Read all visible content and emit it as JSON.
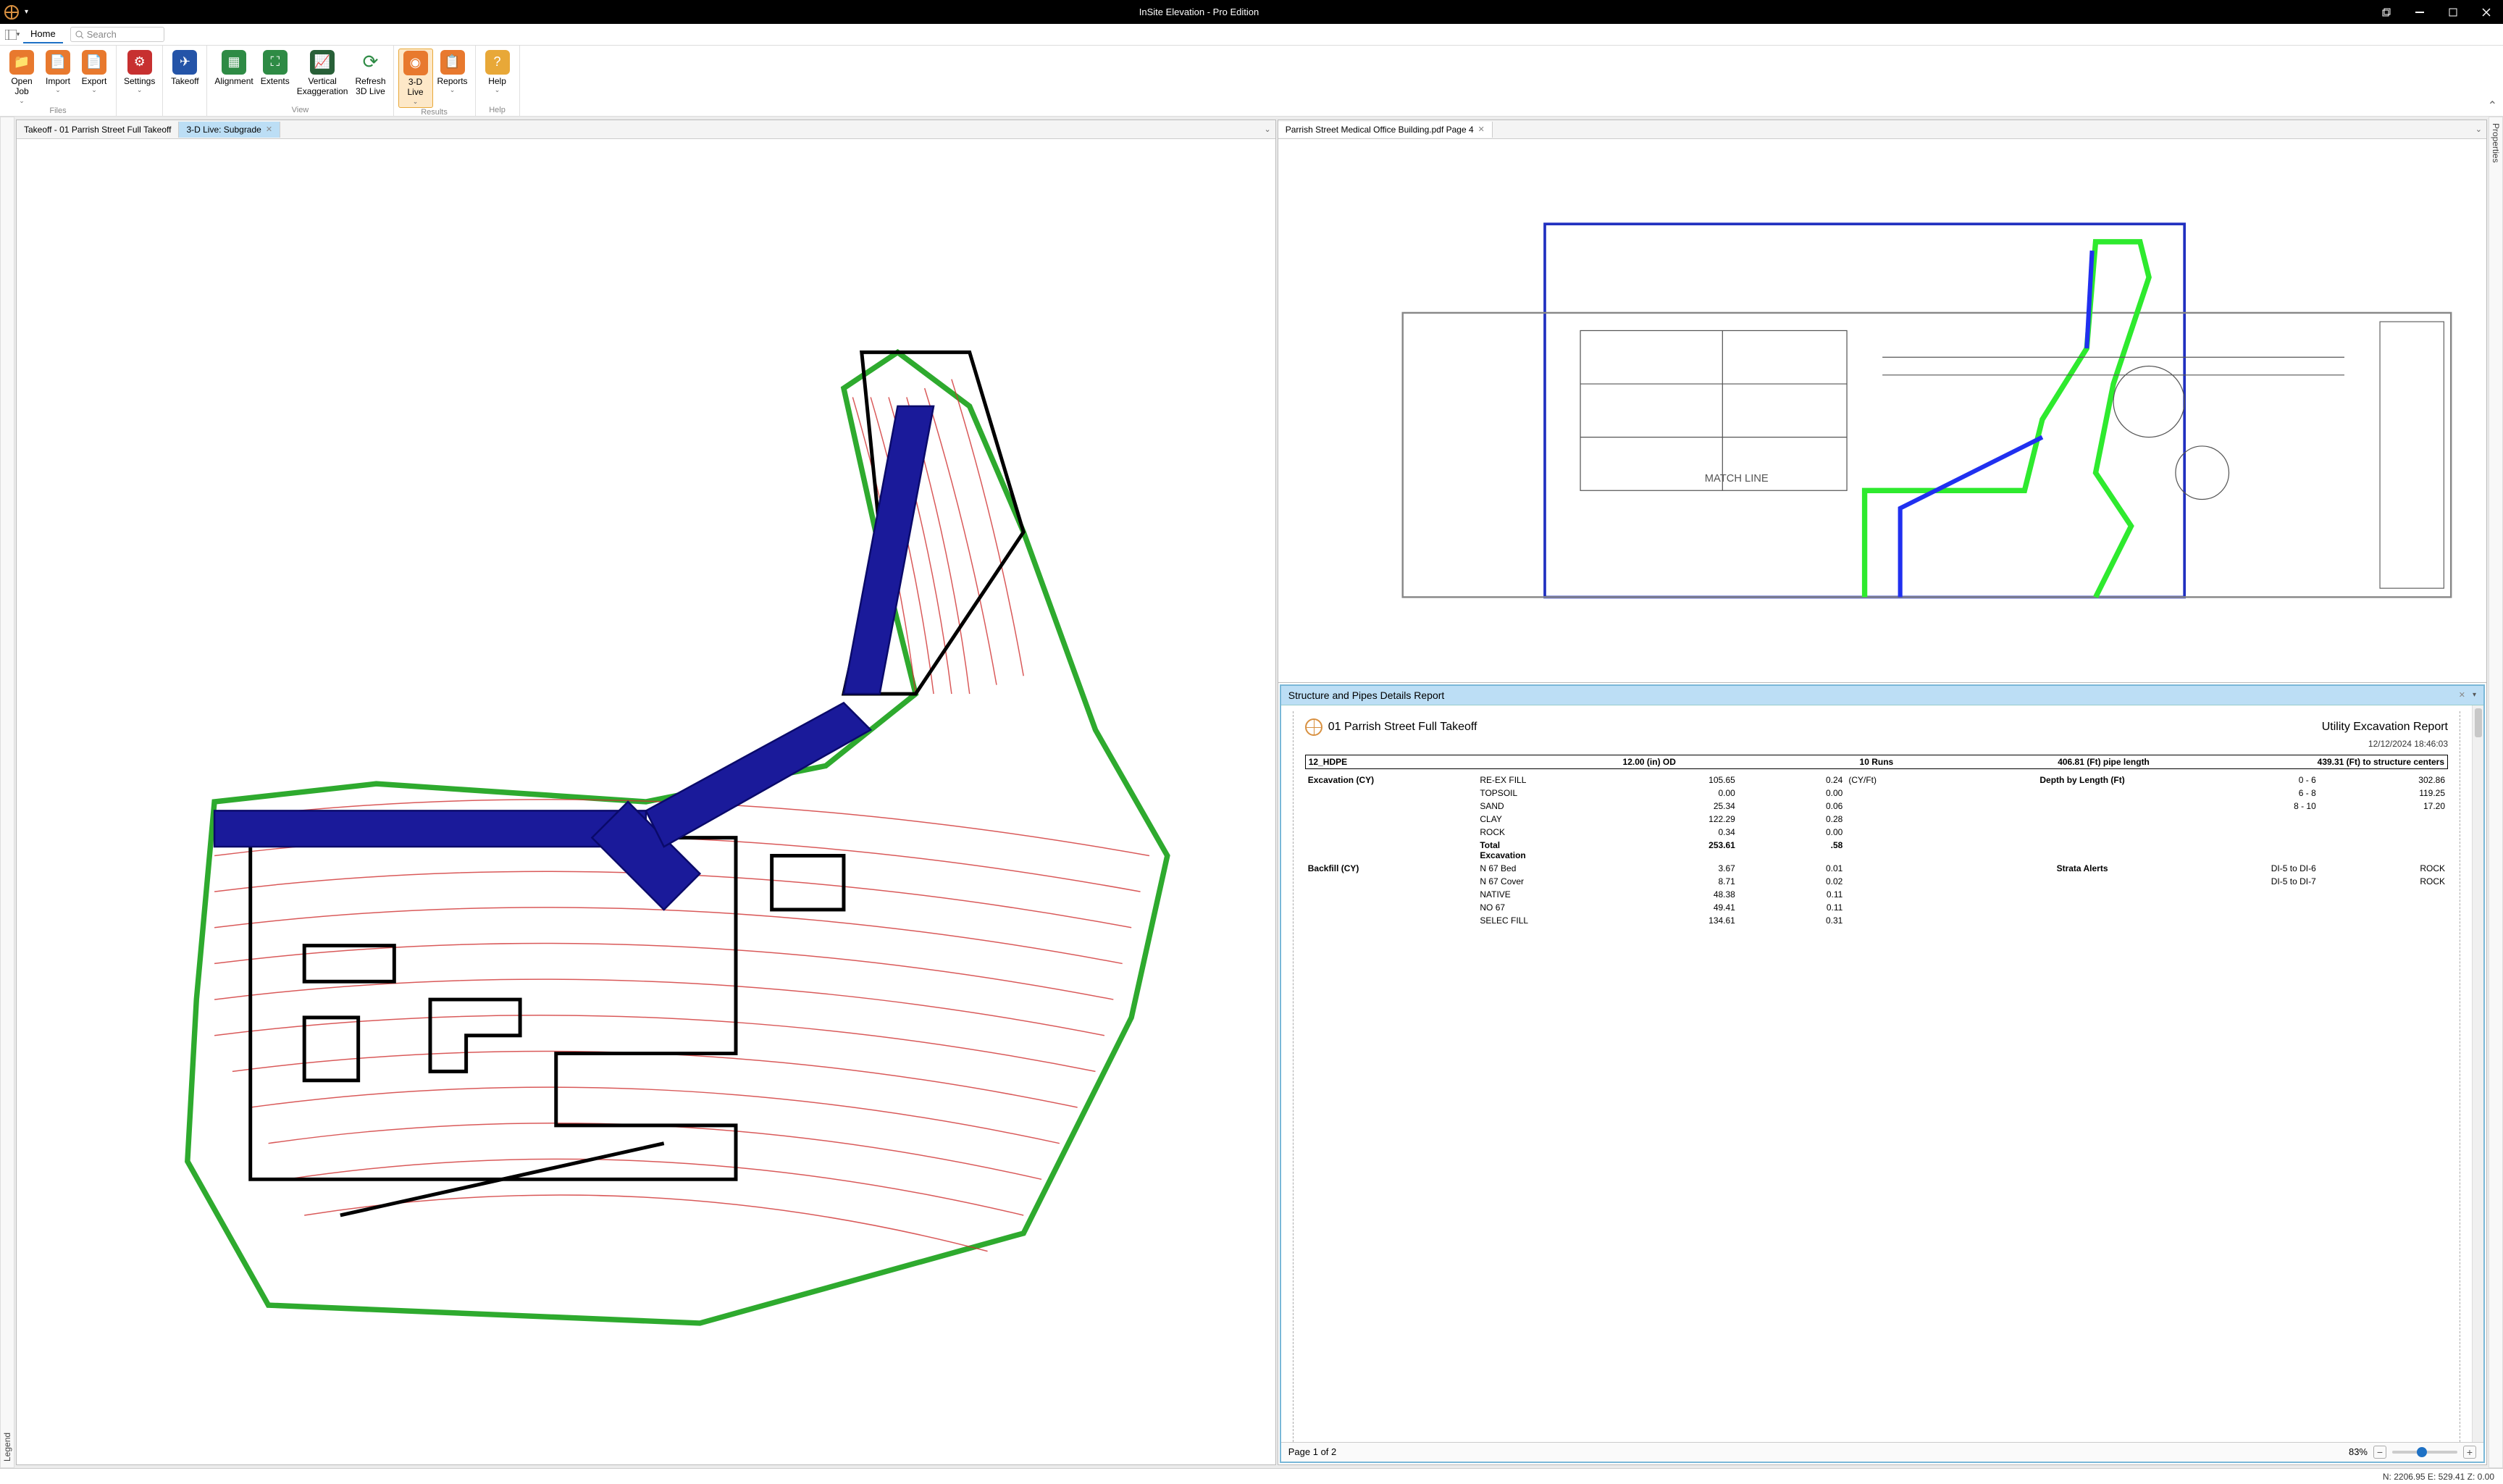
{
  "app": {
    "title": "InSite Elevation - Pro Edition"
  },
  "menu": {
    "home": "Home",
    "search_placeholder": "Search"
  },
  "ribbon": {
    "open_job": "Open\nJob",
    "import": "Import",
    "export": "Export",
    "settings": "Settings",
    "takeoff": "Takeoff",
    "alignment": "Alignment",
    "extents": "Extents",
    "vexag": "Vertical\nExaggeration",
    "refresh": "Refresh\n3D Live",
    "live3d": "3-D\nLive",
    "reports": "Reports",
    "help": "Help",
    "grp_files": "Files",
    "grp_view": "View",
    "grp_results": "Results",
    "grp_help": "Help"
  },
  "side": {
    "legend": "Legend",
    "properties": "Properties"
  },
  "tabs": {
    "left1": "Takeoff - 01 Parrish Street Full Takeoff",
    "left2": "3-D Live: Subgrade",
    "right1": "Parrish Street Medical Office Building.pdf Page 4"
  },
  "report": {
    "panel_title": "Structure and Pipes Details Report",
    "title_left": "01 Parrish Street Full Takeoff",
    "title_right": "Utility Excavation Report",
    "datetime": "12/12/2024   18:46:03",
    "section": {
      "name": "12_HDPE",
      "od": "12.00 (in) OD",
      "runs": "10 Runs",
      "pipe": "406.81 (Ft) pipe length",
      "centers": "439.31 (Ft) to structure centers"
    },
    "exc_label": "Excavation (CY)",
    "depth_label": "Depth by Length (Ft)",
    "exc": [
      {
        "m": "RE-EX FILL",
        "cy": "105.65",
        "rate": "0.24",
        "unit": "(CY/Ft)"
      },
      {
        "m": "TOPSOIL",
        "cy": "0.00",
        "rate": "0.00",
        "unit": ""
      },
      {
        "m": "SAND",
        "cy": "25.34",
        "rate": "0.06",
        "unit": ""
      },
      {
        "m": "CLAY",
        "cy": "122.29",
        "rate": "0.28",
        "unit": ""
      },
      {
        "m": "ROCK",
        "cy": "0.34",
        "rate": "0.00",
        "unit": ""
      }
    ],
    "exc_total": {
      "label": "Total\nExcavation",
      "cy": "253.61",
      "rate": ".58"
    },
    "depth": [
      {
        "r": "0 - 6",
        "v": "302.86"
      },
      {
        "r": "6 - 8",
        "v": "119.25"
      },
      {
        "r": "8 - 10",
        "v": "17.20"
      }
    ],
    "back_label": "Backfill (CY)",
    "strata_label": "Strata Alerts",
    "back": [
      {
        "m": "N 67 Bed",
        "cy": "3.67",
        "rate": "0.01"
      },
      {
        "m": "N 67 Cover",
        "cy": "8.71",
        "rate": "0.02"
      },
      {
        "m": "NATIVE",
        "cy": "48.38",
        "rate": "0.11"
      },
      {
        "m": "NO 67",
        "cy": "49.41",
        "rate": "0.11"
      },
      {
        "m": "SELEC FILL",
        "cy": "134.61",
        "rate": "0.31"
      }
    ],
    "strata": [
      {
        "r": "DI-5 to DI-6",
        "v": "ROCK"
      },
      {
        "r": "DI-5 to DI-7",
        "v": "ROCK"
      }
    ],
    "footer": {
      "page": "Page 1 of 2",
      "zoom": "83%"
    }
  },
  "status": {
    "coords": "N: 2206.95  E: 529.41  Z: 0.00"
  }
}
